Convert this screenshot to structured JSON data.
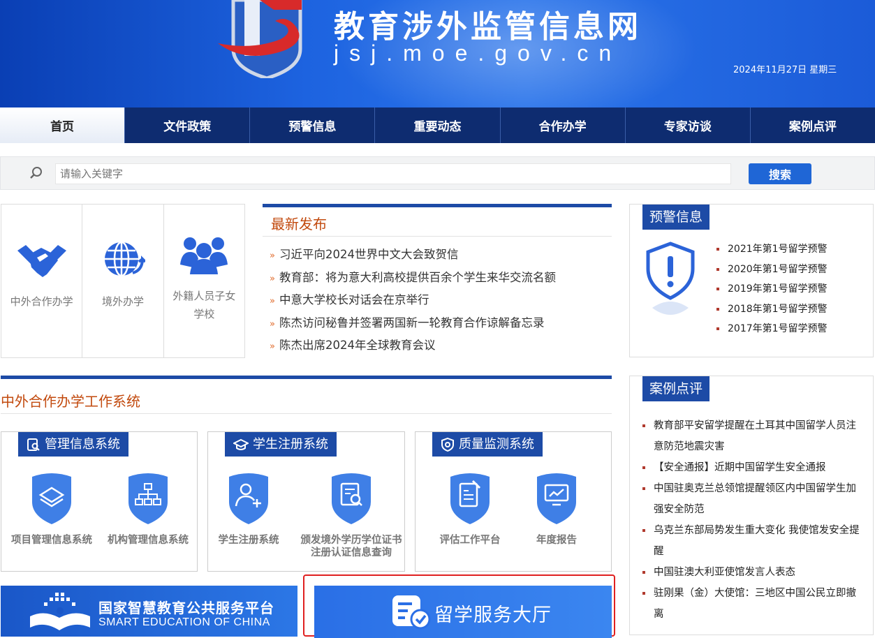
{
  "header": {
    "site_title": "教育涉外监管信息网",
    "site_url": "jsj.moe.gov.cn",
    "date": "2024年11月27日  星期三"
  },
  "nav": {
    "items": [
      {
        "label": "首页",
        "active": true
      },
      {
        "label": "文件政策"
      },
      {
        "label": "预警信息"
      },
      {
        "label": "重要动态"
      },
      {
        "label": "合作办学"
      },
      {
        "label": "专家访谈"
      },
      {
        "label": "案例点评"
      }
    ]
  },
  "search": {
    "placeholder": "请输入关键字",
    "button": "搜索"
  },
  "quick_links": [
    {
      "label": "中外合作办学",
      "icon": "handshake-icon"
    },
    {
      "label": "境外办学",
      "icon": "globe-icon"
    },
    {
      "label": "外籍人员子女学校",
      "icon": "people-group-icon"
    }
  ],
  "latest": {
    "title": "最新发布",
    "items": [
      "习近平向2024世界中文大会致贺信",
      "教育部：将为意大利高校提供百余个学生来华交流名额",
      "中意大学校长对话会在京举行",
      "陈杰访问秘鲁并签署两国新一轮教育合作谅解备忘录",
      "陈杰出席2024年全球教育会议"
    ]
  },
  "warning": {
    "title": "预警信息",
    "items": [
      "2021年第1号留学预警",
      "2020年第1号留学预警",
      "2019年第1号留学预警",
      "2018年第1号留学预警",
      "2017年第1号留学预警"
    ]
  },
  "cases": {
    "title": "案例点评",
    "items": [
      "教育部平安留学提醒在土耳其中国留学人员注意防范地震灾害",
      "【安全通报】近期中国留学生安全通报",
      "中国驻奥克兰总领馆提醒领区内中国留学生加强安全防范",
      "乌克兰东部局势发生重大变化 我使馆发安全提醒",
      "中国驻澳大利亚使馆发言人表态",
      "驻刚果（金）大使馆：三地区中国公民立即撤离"
    ]
  },
  "system": {
    "title": "中外合作办学工作系统",
    "boxes": [
      {
        "tag": "管理信息系统",
        "tag_icon": "document-search-icon",
        "items": [
          {
            "label": "项目管理信息系统",
            "icon": "layers-icon"
          },
          {
            "label": "机构管理信息系统",
            "icon": "org-chart-icon"
          }
        ]
      },
      {
        "tag": "学生注册系统",
        "tag_icon": "graduation-cap-icon",
        "items": [
          {
            "label": "学生注册系统",
            "icon": "user-add-icon"
          },
          {
            "label": "颁发境外学历学位证书注册认证信息查询",
            "icon": "document-search-icon"
          }
        ]
      },
      {
        "tag": "质量监测系统",
        "tag_icon": "shield-check-icon",
        "items": [
          {
            "label": "评估工作平台",
            "icon": "edit-document-icon"
          },
          {
            "label": "年度报告",
            "icon": "chart-monitor-icon"
          }
        ]
      }
    ]
  },
  "banners": {
    "smart_edu_cn": "国家智慧教育公共服务平台",
    "smart_edu_en": "SMART EDUCATION OF CHINA",
    "study_hall": "留学服务大厅"
  },
  "colors": {
    "nav_bg": "#0e2c70",
    "accent_blue": "#1d4ba6",
    "section_title": "#c24a0e",
    "highlight_border": "#e02020"
  }
}
